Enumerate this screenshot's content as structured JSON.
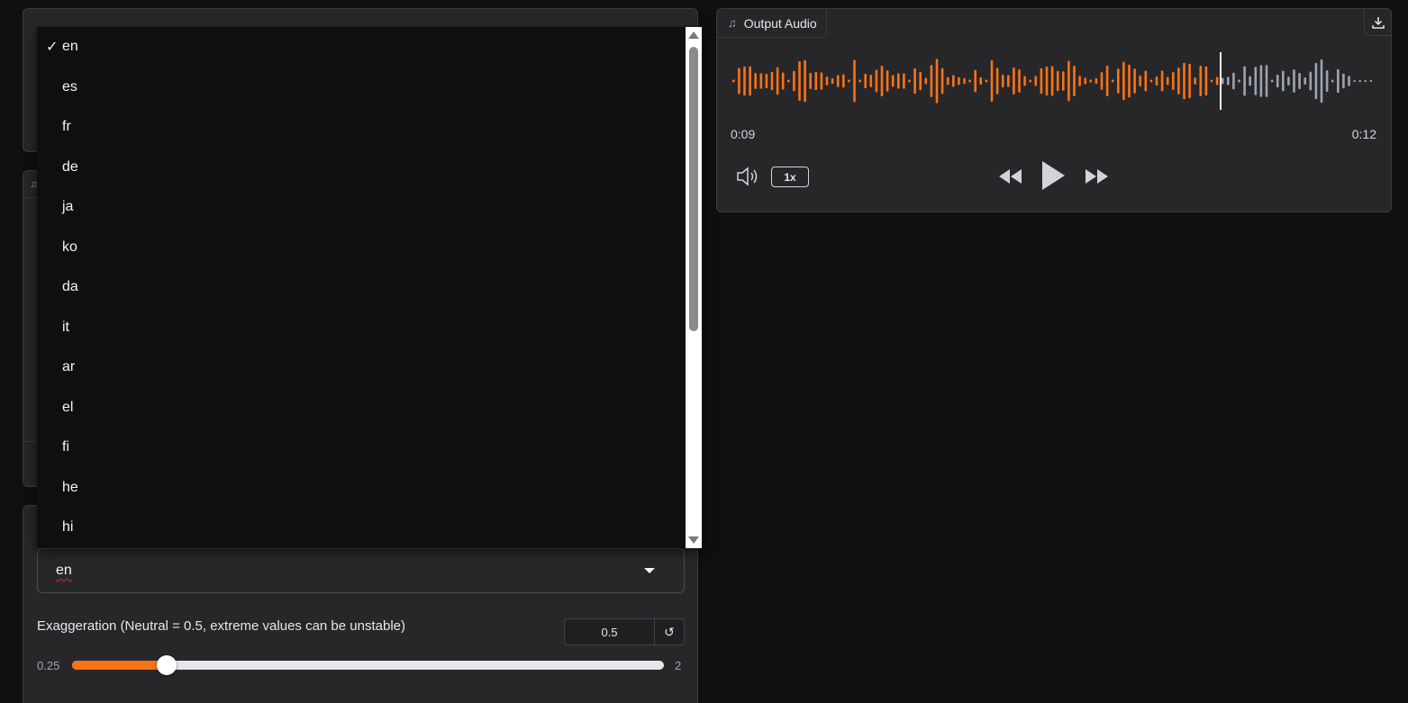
{
  "language_select": {
    "value": "en",
    "options": [
      "en",
      "es",
      "fr",
      "de",
      "ja",
      "ko",
      "da",
      "it",
      "ar",
      "el",
      "fi",
      "he",
      "hi"
    ],
    "selected_index": 0,
    "check_mark": "✓"
  },
  "exaggeration": {
    "label": "Exaggeration (Neutral = 0.5, extreme values can be unstable)",
    "value": "0.5",
    "min": "0.25",
    "max": "2",
    "value_num": 0.5,
    "min_num": 0.25,
    "max_num": 2,
    "reset_icon": "↺"
  },
  "output_audio": {
    "label": "Output Audio",
    "current_time": "0:09",
    "total_time": "0:12",
    "speed": "1x",
    "progress": 0.75,
    "played_color": "#f97316",
    "unplayed_color": "#9ca3af",
    "icons": {
      "tab": "music-note-icon",
      "download": "download-icon",
      "volume": "volume-icon",
      "rewind": "rewind-icon",
      "play": "play-icon",
      "forward": "fast-forward-icon"
    }
  },
  "theme": {
    "accent": "#f97316",
    "background": "#0f0f11",
    "panel": "#27272a"
  }
}
